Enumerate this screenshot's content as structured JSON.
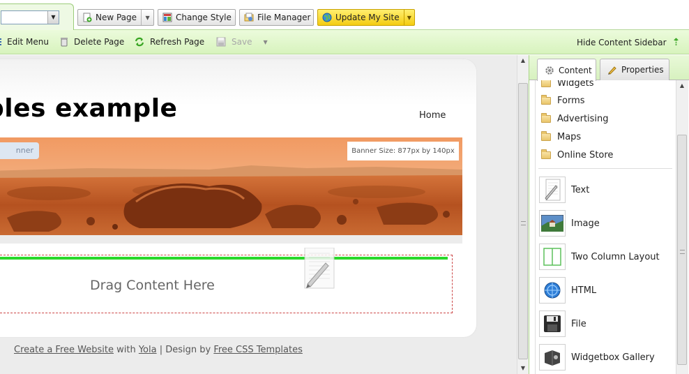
{
  "toolbar": {
    "page_select_value": "",
    "new_page": "New Page",
    "change_style": "Change Style",
    "file_manager": "File Manager",
    "update_site": "Update My Site"
  },
  "subtoolbar": {
    "edit_menu": "Edit Menu",
    "delete_page": "Delete Page",
    "refresh_page": "Refresh Page",
    "save": "Save",
    "hide_sidebar": "Hide Content Sidebar"
  },
  "site": {
    "title": "bles example",
    "nav_home": "Home",
    "banner_pill": "nner",
    "banner_size": "Banner Size: 877px by 140px",
    "drop_text": "Drag Content Here"
  },
  "footer": {
    "create_link": "Create a Free Website",
    "with": " with ",
    "yola": "Yola",
    "sep": " | Design by ",
    "templates": "Free CSS Templates"
  },
  "sidebar": {
    "tabs": [
      "Content",
      "Properties"
    ],
    "folders": [
      "Widgets",
      "Forms",
      "Advertising",
      "Maps",
      "Online Store"
    ],
    "widgets": [
      "Text",
      "Image",
      "Two Column Layout",
      "HTML",
      "File",
      "Widgetbox Gallery"
    ]
  },
  "colors": {
    "accent_green": "#2ad82a",
    "toolbar_green": "#d7f3bd",
    "update_yellow": "#f4cc12"
  }
}
